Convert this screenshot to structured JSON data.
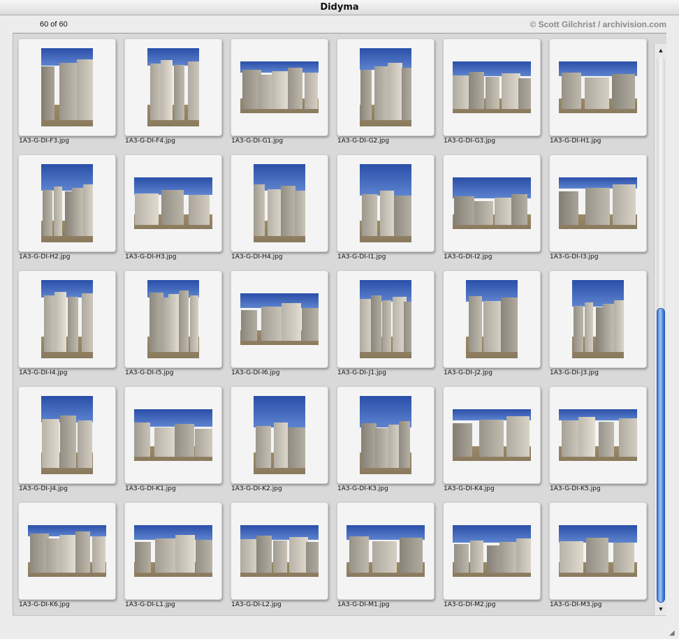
{
  "window": {
    "title": "Didyma"
  },
  "info": {
    "count": "60 of 60",
    "credit": "© Scott Gilchrist / archivision.com"
  },
  "scroll": {
    "position_fraction": 0.5,
    "visible_fraction": 0.57
  },
  "colors": {
    "sky": "#2a4fa8",
    "stone": "#c9c2b3",
    "ground": "#8a7a5e",
    "scroll_accent": "#3c76d6"
  },
  "icons": {
    "scroll_up": "scroll-up-arrow-icon",
    "scroll_down": "scroll-down-arrow-icon",
    "resize": "resize-grip-icon"
  },
  "thumbnails": [
    {
      "name": "1A3-G-DI-F3.jpg",
      "orientation": "portrait"
    },
    {
      "name": "1A3-G-DI-F4.jpg",
      "orientation": "portrait"
    },
    {
      "name": "1A3-G-DI-G1.jpg",
      "orientation": "landscape"
    },
    {
      "name": "1A3-G-DI-G2.jpg",
      "orientation": "portrait"
    },
    {
      "name": "1A3-G-DI-G3.jpg",
      "orientation": "landscape"
    },
    {
      "name": "1A3-G-DI-H1.jpg",
      "orientation": "landscape"
    },
    {
      "name": "1A3-G-DI-H2.jpg",
      "orientation": "portrait"
    },
    {
      "name": "1A3-G-DI-H3.jpg",
      "orientation": "landscape"
    },
    {
      "name": "1A3-G-DI-H4.jpg",
      "orientation": "portrait"
    },
    {
      "name": "1A3-G-DI-I1.jpg",
      "orientation": "portrait"
    },
    {
      "name": "1A3-G-DI-I2.jpg",
      "orientation": "landscape"
    },
    {
      "name": "1A3-G-DI-I3.jpg",
      "orientation": "landscape"
    },
    {
      "name": "1A3-G-DI-I4.jpg",
      "orientation": "portrait"
    },
    {
      "name": "1A3-G-DI-I5.jpg",
      "orientation": "portrait"
    },
    {
      "name": "1A3-G-DI-I6.jpg",
      "orientation": "landscape"
    },
    {
      "name": "1A3-G-DI-J1.jpg",
      "orientation": "portrait"
    },
    {
      "name": "1A3-G-DI-J2.jpg",
      "orientation": "portrait"
    },
    {
      "name": "1A3-G-DI-J3.jpg",
      "orientation": "portrait"
    },
    {
      "name": "1A3-G-DI-J4.jpg",
      "orientation": "portrait"
    },
    {
      "name": "1A3-G-DI-K1.jpg",
      "orientation": "landscape"
    },
    {
      "name": "1A3-G-DI-K2.jpg",
      "orientation": "portrait"
    },
    {
      "name": "1A3-G-DI-K3.jpg",
      "orientation": "portrait"
    },
    {
      "name": "1A3-G-DI-K4.jpg",
      "orientation": "landscape"
    },
    {
      "name": "1A3-G-DI-K5.jpg",
      "orientation": "landscape"
    },
    {
      "name": "1A3-G-DI-K6.jpg",
      "orientation": "landscape"
    },
    {
      "name": "1A3-G-DI-L1.jpg",
      "orientation": "landscape"
    },
    {
      "name": "1A3-G-DI-L2.jpg",
      "orientation": "landscape"
    },
    {
      "name": "1A3-G-DI-M1.jpg",
      "orientation": "landscape"
    },
    {
      "name": "1A3-G-DI-M2.jpg",
      "orientation": "landscape"
    },
    {
      "name": "1A3-G-DI-M3.jpg",
      "orientation": "landscape"
    }
  ]
}
